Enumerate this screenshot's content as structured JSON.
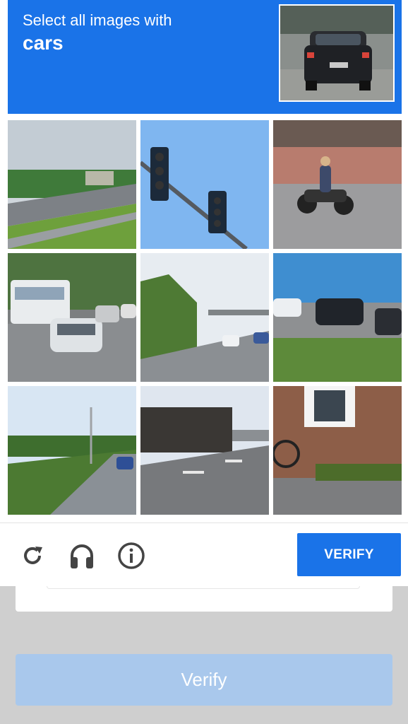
{
  "challenge": {
    "prompt": "Select all images with",
    "target": "cars",
    "verify_label": "VERIFY"
  },
  "controls": {
    "reload_icon": "reload-icon",
    "audio_icon": "headphones-icon",
    "info_icon": "info-icon"
  },
  "page": {
    "verify_label": "Verify"
  },
  "colors": {
    "accent": "#1a73e8",
    "disabled_button": "#a9c8ec",
    "backdrop": "#cfcfcf"
  }
}
